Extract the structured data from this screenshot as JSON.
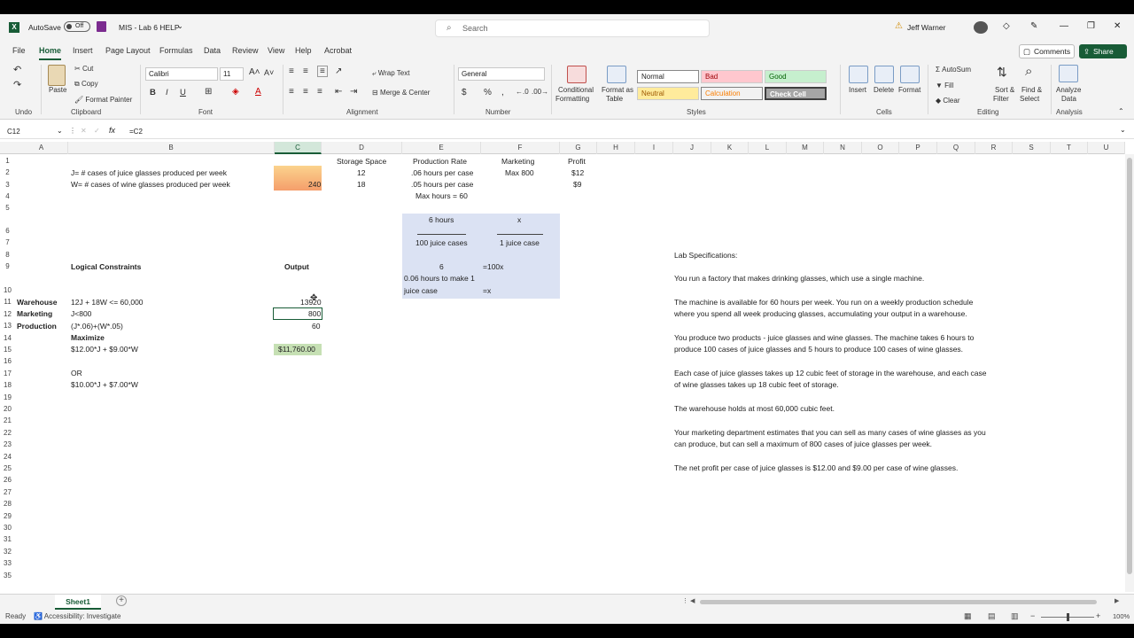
{
  "titlebar": {
    "autosave_label": "AutoSave",
    "autosave_state": "Off",
    "file_name": "MIS - Lab 6  HELP",
    "search_placeholder": "Search",
    "user_name": "Jeff Warner",
    "minimize": "—",
    "restore": "❐",
    "close": "✕"
  },
  "menu": {
    "tabs": [
      "File",
      "Home",
      "Insert",
      "Page Layout",
      "Formulas",
      "Data",
      "Review",
      "View",
      "Help",
      "Acrobat"
    ],
    "comments": "Comments",
    "share": "Share"
  },
  "ribbon": {
    "undo_group": "Undo",
    "paste": "Paste",
    "cut": "Cut",
    "copy": "Copy",
    "format_painter": "Format Painter",
    "clipboard_group": "Clipboard",
    "font_name": "Calibri",
    "font_size": "11",
    "font_group": "Font",
    "wrap_text": "Wrap Text",
    "merge_center": "Merge & Center",
    "alignment_group": "Alignment",
    "number_format": "General",
    "number_group": "Number",
    "conditional_formatting": "Conditional",
    "conditional_formatting_2": "Formatting",
    "format_as_table": "Format as",
    "format_as_table_2": "Table",
    "styles": {
      "normal": "Normal",
      "bad": "Bad",
      "good": "Good",
      "neutral": "Neutral",
      "calculation": "Calculation",
      "check_cell": "Check Cell"
    },
    "styles_group": "Styles",
    "insert": "Insert",
    "delete": "Delete",
    "format": "Format",
    "cells_group": "Cells",
    "autosum": "AutoSum",
    "fill": "Fill",
    "clear": "Clear",
    "sort_filter": "Sort &",
    "sort_filter_2": "Filter",
    "find_select": "Find &",
    "find_select_2": "Select",
    "editing_group": "Editing",
    "analyze_data": "Analyze",
    "analyze_data_2": "Data",
    "analysis_group": "Analysis"
  },
  "formula_bar": {
    "name_box": "C12",
    "fx": "fx",
    "formula": "=C2"
  },
  "columns": [
    "A",
    "B",
    "C",
    "D",
    "E",
    "F",
    "G",
    "H",
    "I",
    "J",
    "K",
    "L",
    "M",
    "N",
    "O",
    "P",
    "Q",
    "R",
    "S",
    "T",
    "U"
  ],
  "rows": [
    "1",
    "2",
    "3",
    "4",
    "5",
    "6",
    "7",
    "8",
    "9",
    "10",
    "11",
    "12",
    "13",
    "14",
    "15",
    "16",
    "17",
    "18",
    "19",
    "20",
    "21",
    "22",
    "23",
    "24",
    "25",
    "26",
    "27",
    "28",
    "29",
    "30",
    "31",
    "32",
    "33",
    "35"
  ],
  "cells": {
    "b2": "J= # cases of juice glasses produced per week",
    "b3": "W= # cases of wine glasses produced per week",
    "c3": "240",
    "d1": "Storage Space",
    "d2": "12",
    "d3": "18",
    "e1": "Production Rate",
    "e2": ".06 hours per case",
    "e3": ".05 hours per case",
    "e4": "Max hours = 60",
    "f1": "Marketing",
    "f2": "Max 800",
    "g1": "Profit",
    "g2": "$12",
    "g3": "$9",
    "e5": "6 hours",
    "f5": "x",
    "e7": "100 juice cases",
    "f7": "1 juice case",
    "e9": "6",
    "f9": "=100x",
    "e10a": "0.06 hours to make 1",
    "e10b": "juice case",
    "f10": "=x",
    "b9": "Logical Constraints",
    "c9": "Output",
    "a11": "Warehouse",
    "b11": "12J + 18W <= 60,000",
    "c11": "13920",
    "a12": "Marketing",
    "b12": "J<800",
    "c12": "800",
    "a13": "Production",
    "b13": "(J*.06)+(W*.05)",
    "c13": "60",
    "b14": "Maximize",
    "b15": "$12.00*J + $9.00*W",
    "c15": "$11,760.00",
    "b17": "OR",
    "b18": "$10.00*J + $7.00*W"
  },
  "specs": {
    "heading": "Lab Specifications:",
    "p1": "You run a factory that makes drinking glasses, which use a single machine.",
    "p2a": "The machine is available for 60 hours per week. You run on a weekly production schedule",
    "p2b": "where you spend all week producing glasses, accumulating your output in a warehouse.",
    "p3a": "You produce two products - juice glasses and wine glasses. The machine takes 6 hours to",
    "p3b": "produce 100 cases of juice glasses and 5 hours to produce 100 cases of wine glasses.",
    "p4a": "Each case of juice glasses takes up 12 cubic feet of storage in the warehouse, and each case",
    "p4b": "of wine glasses takes up 18 cubic feet of storage.",
    "p5": "The warehouse holds at most 60,000 cubic feet.",
    "p6a": " Your marketing department estimates that you can sell as many cases of wine glasses as you",
    "p6b": "can produce, but can sell a maximum of 800 cases of juice glasses per week.",
    "p7": "The net profit per case of juice glasses is $12.00 and $9.00 per case of wine glasses."
  },
  "sheet_tab": "Sheet1",
  "status": {
    "ready": "Ready",
    "accessibility": "Accessibility: Investigate",
    "zoom": "100%"
  },
  "colors": {
    "excel_green": "#185c37",
    "blue_box": "#dbe2f3",
    "output_green": "#c6e0b4",
    "orange_start": "#fbd38d",
    "orange_end": "#f59e6b"
  }
}
